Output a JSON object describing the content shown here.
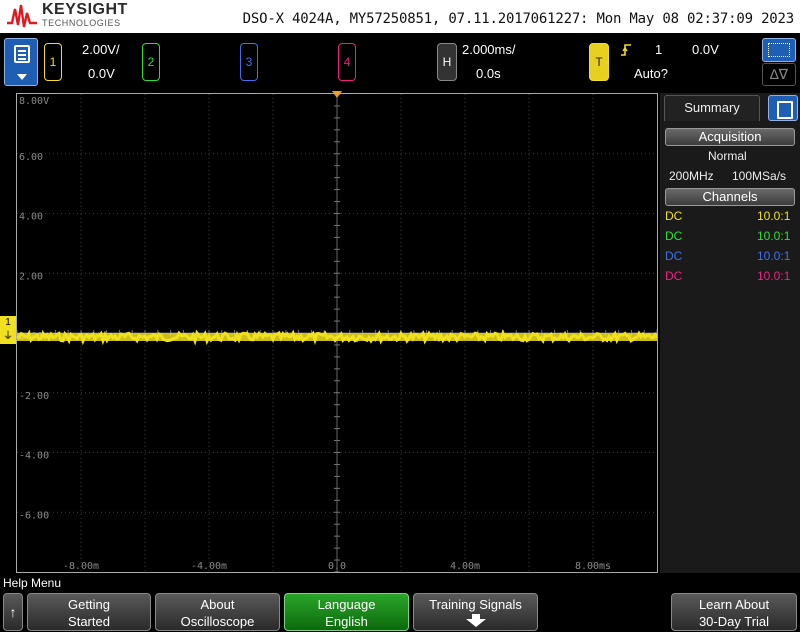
{
  "header": {
    "brand": "KEYSIGHT",
    "brand_sub": "TECHNOLOGIES",
    "title": "DSO-X 4024A, MY57250851, 07.11.2017061227: Mon May 08 02:37:09 2023"
  },
  "channels": [
    {
      "num": "1",
      "scale": "2.00V/",
      "offset": "0.0V",
      "color": "#f0e020"
    },
    {
      "num": "2",
      "scale": "",
      "offset": "",
      "color": "#2ee02e"
    },
    {
      "num": "3",
      "scale": "",
      "offset": "",
      "color": "#4070f0"
    },
    {
      "num": "4",
      "scale": "",
      "offset": "",
      "color": "#f02080"
    }
  ],
  "horizontal": {
    "label": "H",
    "timebase": "2.000ms/",
    "delay": "0.0s"
  },
  "trigger": {
    "label": "T",
    "slope_icon": "rising-edge-icon",
    "source": "1",
    "level": "0.0V",
    "mode": "Auto?"
  },
  "plot": {
    "y_labels": [
      "8.00V",
      "6.00",
      "4.00",
      "2.00",
      "0.00",
      "-2.00",
      "-4.00",
      "-6.00"
    ],
    "x_labels": [
      "-8.00m",
      "-4.00m",
      "0.0",
      "4.00m",
      "8.00ms"
    ],
    "channel_marker": "1",
    "trace_color": "#f0e020"
  },
  "panel": {
    "tab": "Summary",
    "acquisition_head": "Acquisition",
    "acq_mode": "Normal",
    "bandwidth": "200MHz",
    "sample_rate": "100MSa/s",
    "channels_head": "Channels",
    "rows": [
      {
        "coupling": "DC",
        "probe": "10.0:1",
        "color": "#f0e020"
      },
      {
        "coupling": "DC",
        "probe": "10.0:1",
        "color": "#2ee02e"
      },
      {
        "coupling": "DC",
        "probe": "10.0:1",
        "color": "#4070f0"
      },
      {
        "coupling": "DC",
        "probe": "10.0:1",
        "color": "#f02080"
      }
    ]
  },
  "softkeys": {
    "title": "Help Menu",
    "up_glyph": "↑",
    "keys": [
      {
        "line1": "Getting",
        "line2": "Started"
      },
      {
        "line1": "About",
        "line2": "Oscilloscope"
      },
      {
        "line1": "Language",
        "line2": "English"
      },
      {
        "line1": "Training Signals",
        "line2": ""
      },
      {
        "line1": "Learn About",
        "line2": "30-Day Trial"
      }
    ]
  }
}
